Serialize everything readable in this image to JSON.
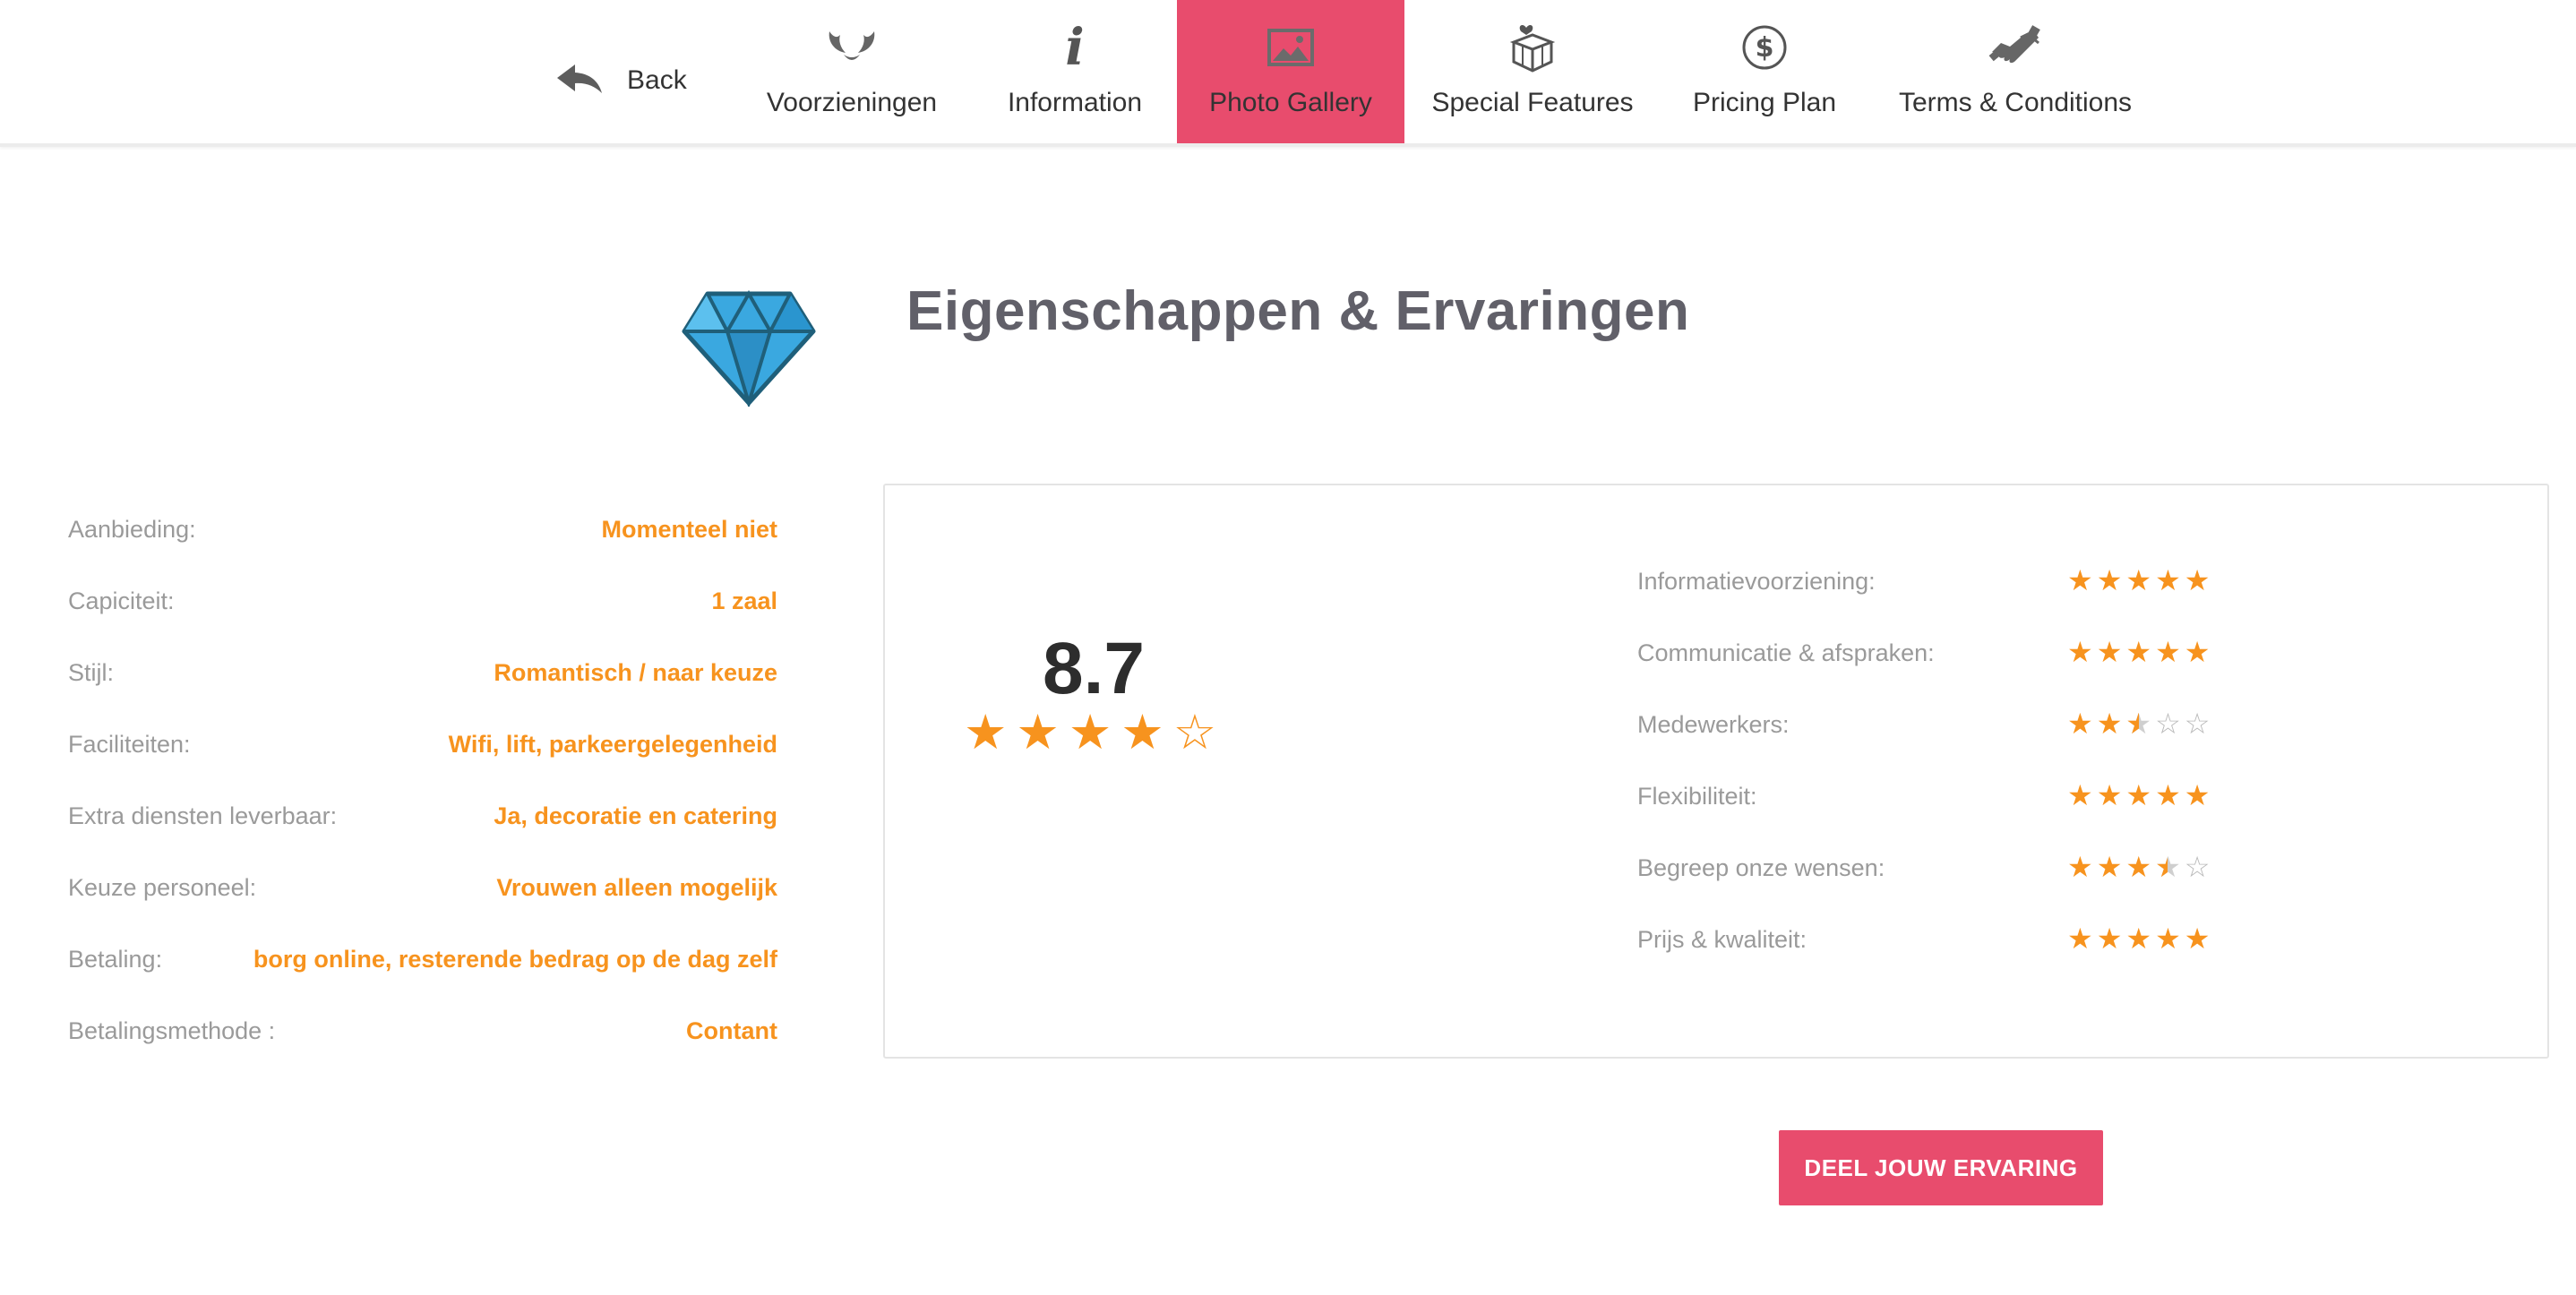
{
  "nav": {
    "back_label": "Back",
    "items": [
      {
        "label": "Voorzieningen",
        "icon": "horns-icon"
      },
      {
        "label": "Information",
        "icon": "info-icon"
      },
      {
        "label": "Photo Gallery",
        "icon": "image-icon",
        "active": true
      },
      {
        "label": "Special Features",
        "icon": "gift-box-icon"
      },
      {
        "label": "Pricing Plan",
        "icon": "dollar-circle-icon"
      },
      {
        "label": "Terms & Conditions",
        "icon": "handshake-icon"
      }
    ],
    "accent_color": "#e84c6d"
  },
  "header": {
    "title": "Eigenschappen & Ervaringen",
    "icon": "diamond-icon"
  },
  "details": [
    {
      "label": "Aanbieding:",
      "value": "Momenteel niet"
    },
    {
      "label": "Capiciteit:",
      "value": "1 zaal"
    },
    {
      "label": "Stijl:",
      "value": "Romantisch / naar keuze"
    },
    {
      "label": "Faciliteiten:",
      "value": "Wifi, lift, parkeergelegenheid"
    },
    {
      "label": "Extra diensten leverbaar:",
      "value": "Ja, decoratie en catering"
    },
    {
      "label": "Keuze personeel:",
      "value": "Vrouwen alleen mogelijk"
    },
    {
      "label": "Betaling:",
      "value": "borg online, resterende bedrag op de dag zelf"
    },
    {
      "label": "Betalingsmethode :",
      "value": "Contant"
    }
  ],
  "rating": {
    "score": "8.7",
    "stars": 4,
    "max_stars": 5,
    "criteria": [
      {
        "label": "Informatievoorziening:",
        "stars": 5
      },
      {
        "label": "Communicatie & afspraken:",
        "stars": 5
      },
      {
        "label": "Medewerkers:",
        "stars": 2.5
      },
      {
        "label": "Flexibiliteit:",
        "stars": 5
      },
      {
        "label": "Begreep onze wensen:",
        "stars": 3.5
      },
      {
        "label": "Prijs & kwaliteit:",
        "stars": 5
      }
    ]
  },
  "cta_label": "DEEL JOUW ERVARING",
  "colors": {
    "star": "#f7931e",
    "value_text": "#f7931e",
    "title": "#616069"
  }
}
